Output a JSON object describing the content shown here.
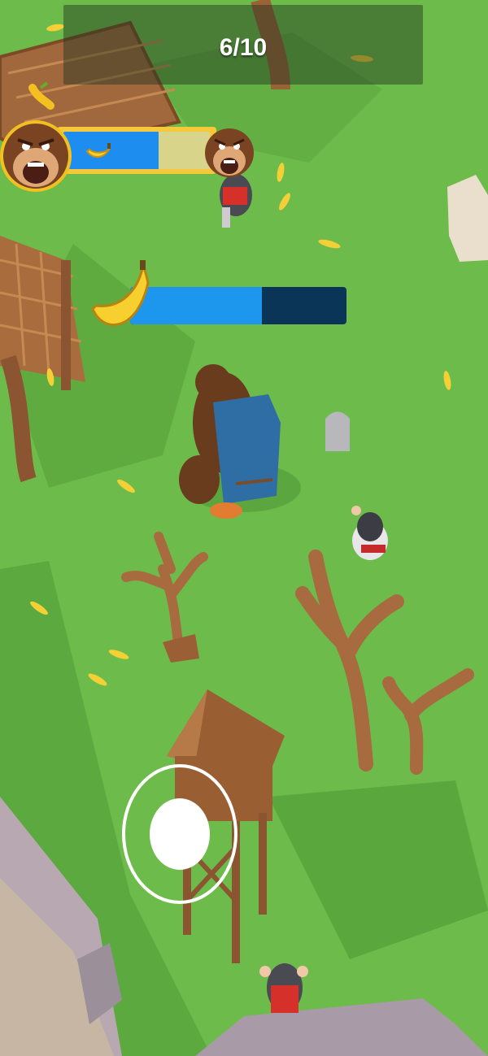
{
  "hud": {
    "counter": "6/10"
  },
  "boss": {
    "portrait_icon": "gorilla-face-icon",
    "banana_icon": "banana-icon",
    "progress": 0.65
  },
  "player": {
    "banana_icon": "banana-icon",
    "banana_progress": 0.61
  },
  "colors": {
    "grass": "#6dbb4a",
    "bar_blue": "#1d96ee",
    "bar_dark": "#0b3557",
    "boss_frame": "#f6c93a"
  }
}
